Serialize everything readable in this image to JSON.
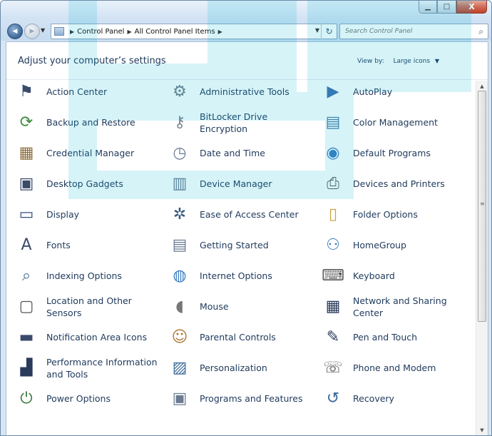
{
  "window": {
    "caption_buttons": {
      "minimize": "▁",
      "maximize": "□",
      "close": "X"
    }
  },
  "nav": {
    "back": "◀",
    "forward": "▶",
    "recent": "▼"
  },
  "address": {
    "crumbs": [
      "Control Panel",
      "All Control Panel Items"
    ],
    "separator": "▶",
    "dropdown": "▼",
    "refresh": "↻"
  },
  "search": {
    "placeholder": "Search Control Panel",
    "icon": "⌕"
  },
  "header": {
    "title": "Adjust your computer’s settings",
    "view_by_label": "View by:",
    "view_by_value": "Large icons",
    "caret": "▼"
  },
  "scrollbar": {
    "up": "▲",
    "down": "▼",
    "grip": "≡"
  },
  "items": [
    {
      "label": "Action Center",
      "icon": "flag-icon",
      "glyph": "⚑",
      "color": "#3a4a6a"
    },
    {
      "label": "Administrative Tools",
      "icon": "admin-tools-icon",
      "glyph": "⚙",
      "color": "#6f7b87"
    },
    {
      "label": "AutoPlay",
      "icon": "autoplay-icon",
      "glyph": "▶",
      "color": "#3f6fb0"
    },
    {
      "label": "Backup and Restore",
      "icon": "backup-icon",
      "glyph": "⟳",
      "color": "#3b8a3b"
    },
    {
      "label": "BitLocker Drive Encryption",
      "icon": "bitlocker-icon",
      "glyph": "⚷",
      "color": "#7b8590"
    },
    {
      "label": "Color Management",
      "icon": "color-management-icon",
      "glyph": "▤",
      "color": "#4b7aa7"
    },
    {
      "label": "Credential Manager",
      "icon": "credential-icon",
      "glyph": "▦",
      "color": "#8a6d3a"
    },
    {
      "label": "Date and Time",
      "icon": "clock-icon",
      "glyph": "◷",
      "color": "#6b7b92"
    },
    {
      "label": "Default Programs",
      "icon": "default-programs-icon",
      "glyph": "◉",
      "color": "#3a7bbf"
    },
    {
      "label": "Desktop Gadgets",
      "icon": "gadgets-icon",
      "glyph": "▣",
      "color": "#3a4a6a"
    },
    {
      "label": "Device Manager",
      "icon": "device-manager-icon",
      "glyph": "▥",
      "color": "#6b7b92"
    },
    {
      "label": "Devices and Printers",
      "icon": "printer-icon",
      "glyph": "⎙",
      "color": "#555555"
    },
    {
      "label": "Display",
      "icon": "display-icon",
      "glyph": "▭",
      "color": "#2f4f7f"
    },
    {
      "label": "Ease of Access Center",
      "icon": "ease-access-icon",
      "glyph": "✲",
      "color": "#3a5a80"
    },
    {
      "label": "Folder Options",
      "icon": "folder-icon",
      "glyph": "▯",
      "color": "#c9a23a"
    },
    {
      "label": "Fonts",
      "icon": "fonts-icon",
      "glyph": "A",
      "color": "#3a4a6a"
    },
    {
      "label": "Getting Started",
      "icon": "getting-started-icon",
      "glyph": "▤",
      "color": "#6b7b92"
    },
    {
      "label": "HomeGroup",
      "icon": "homegroup-icon",
      "glyph": "⚇",
      "color": "#3a7bbf"
    },
    {
      "label": "Indexing Options",
      "icon": "magnifier-icon",
      "glyph": "⌕",
      "color": "#4a6a8a"
    },
    {
      "label": "Internet Options",
      "icon": "globe-icon",
      "glyph": "◍",
      "color": "#3a7bbf"
    },
    {
      "label": "Keyboard",
      "icon": "keyboard-icon",
      "glyph": "⌨",
      "color": "#555555"
    },
    {
      "label": "Location and Other Sensors",
      "icon": "sensors-icon",
      "glyph": "▢",
      "color": "#555555"
    },
    {
      "label": "Mouse",
      "icon": "mouse-icon",
      "glyph": "◖",
      "color": "#777777"
    },
    {
      "label": "Network and Sharing Center",
      "icon": "network-icon",
      "glyph": "▦",
      "color": "#2a3a5a"
    },
    {
      "label": "Notification Area Icons",
      "icon": "notification-icon",
      "glyph": "▬",
      "color": "#3a4a6a"
    },
    {
      "label": "Parental Controls",
      "icon": "parental-controls-icon",
      "glyph": "☺",
      "color": "#b07a3a"
    },
    {
      "label": "Pen and Touch",
      "icon": "pen-icon",
      "glyph": "✎",
      "color": "#2a3a5a"
    },
    {
      "label": "Performance Information and Tools",
      "icon": "performance-icon",
      "glyph": "▟",
      "color": "#2a3a5a"
    },
    {
      "label": "Personalization",
      "icon": "personalization-icon",
      "glyph": "▨",
      "color": "#3a6a9a"
    },
    {
      "label": "Phone and Modem",
      "icon": "phone-icon",
      "glyph": "☏",
      "color": "#555555"
    },
    {
      "label": "Power Options",
      "icon": "power-icon",
      "glyph": "⏻",
      "color": "#3a7a3a"
    },
    {
      "label": "Programs and Features",
      "icon": "programs-icon",
      "glyph": "▣",
      "color": "#6b7b92"
    },
    {
      "label": "Recovery",
      "icon": "recovery-icon",
      "glyph": "↺",
      "color": "#3a6a9a"
    }
  ]
}
